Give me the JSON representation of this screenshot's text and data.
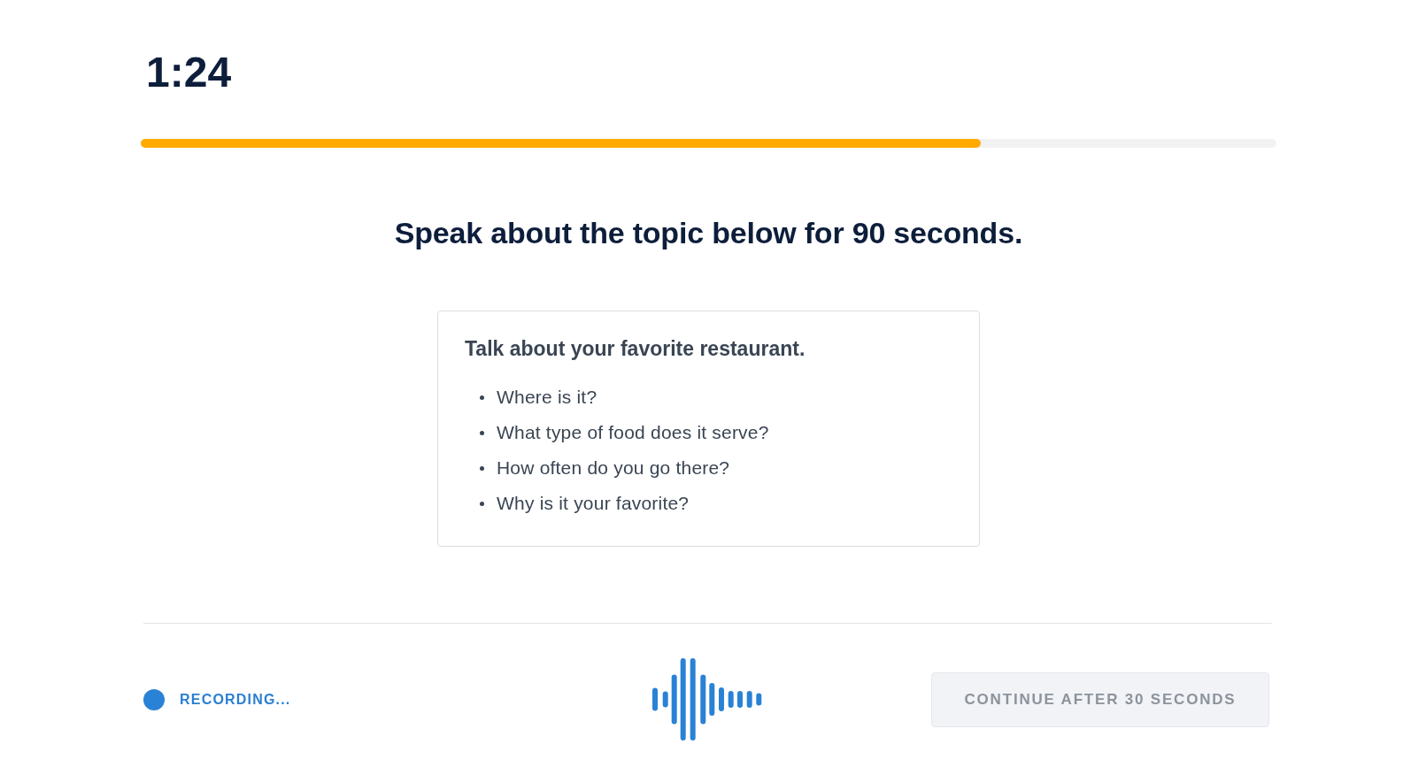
{
  "timer": {
    "time": "1:24"
  },
  "progress": {
    "level": 0.74
  },
  "prompt": {
    "instruction": "Speak about the topic below for 90 seconds."
  },
  "topic_card": {
    "title": "Talk about your favorite restaurant.",
    "points": [
      "Where is it?",
      "What type of food does it serve?",
      "How often do you go there?",
      "Why is it your favorite?"
    ]
  },
  "footer": {
    "status": {
      "label": "RECORDING..."
    },
    "continue_button": {
      "label": "CONTINUE AFTER 30 SECONDS",
      "disabled": true
    }
  }
}
